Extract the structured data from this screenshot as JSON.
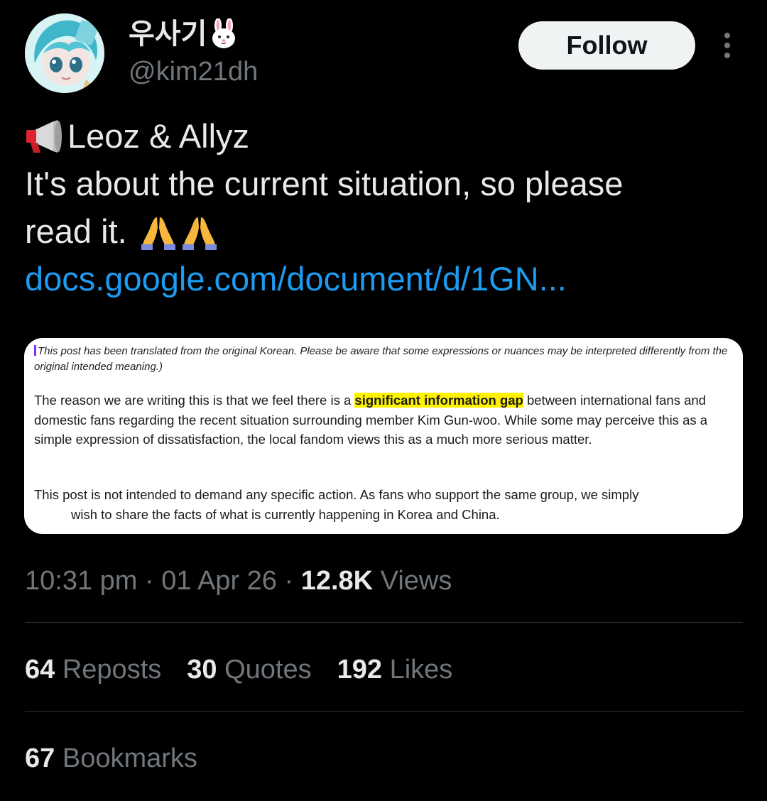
{
  "author": {
    "display_name": "우사기",
    "display_name_emoji": "rabbit-face-icon",
    "handle": "@kim21dh",
    "avatar": "avatar"
  },
  "header": {
    "follow_label": "Follow",
    "more_icon": "more-vertical-icon"
  },
  "tweet": {
    "line1_icon": "megaphone-icon",
    "line1": "Leoz & Allyz",
    "line2": "It's about the current situation, so please",
    "line3": "read it.",
    "line3_emojis": [
      "pray-icon",
      "pray-icon"
    ],
    "link": "docs.google.com/document/d/1GN..."
  },
  "document_image": {
    "note": "This post has been translated from the original Korean. Please be aware that some expressions or nuances may be interpreted differently from the original intended meaning.)",
    "para1_before": "The reason we are writing this is that we feel there is a ",
    "para1_highlight": "significant information gap",
    "para1_after": " between international fans and domestic fans regarding the recent situation surrounding member Kim Gun-woo. While some may perceive this as a simple expression of dissatisfaction, the local fandom views this as a much more serious matter.",
    "para2_line1": "This post is not intended to demand any specific action. As fans who support the same group, we simply",
    "para2_line2": "wish to share the facts of what is currently happening in Korea and China."
  },
  "meta": {
    "time": "10:31 pm",
    "sep1": "·",
    "date": "01 Apr 26",
    "sep2": "·",
    "views_count": "12.8K",
    "views_label": "Views"
  },
  "stats": {
    "reposts_count": "64",
    "reposts_label": "Reposts",
    "quotes_count": "30",
    "quotes_label": "Quotes",
    "likes_count": "192",
    "likes_label": "Likes",
    "bookmarks_count": "67",
    "bookmarks_label": "Bookmarks"
  },
  "colors": {
    "background": "#000000",
    "text_primary": "#e7e9ea",
    "text_secondary": "#71767b",
    "link": "#1d9bf0",
    "divider": "#2f3336",
    "highlight": "#fff200"
  }
}
